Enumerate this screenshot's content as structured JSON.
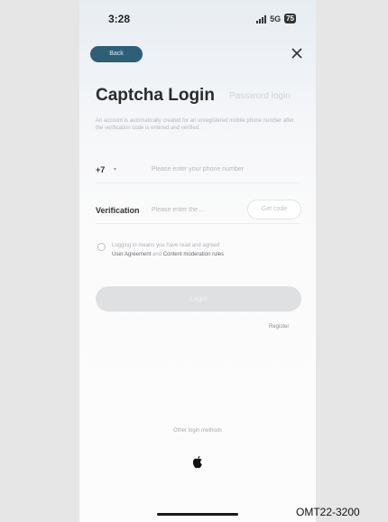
{
  "status_bar": {
    "time": "3:28",
    "network": "5G",
    "battery": "75"
  },
  "header": {
    "back_label": "Back"
  },
  "tabs": {
    "active": "Captcha Login",
    "inactive": "Password login"
  },
  "notice": "An account is automatically created for an unregistered mobile phone number after the verification code is entered and verified.",
  "phone": {
    "country_code": "+7",
    "placeholder": "Please enter your phone number"
  },
  "verification": {
    "label": "Verification",
    "placeholder": "Please enter the ...",
    "get_code_label": "Get code"
  },
  "agreement": {
    "prefix": "Logging in means you have read and agreed",
    "link1": "User Agreement",
    "conjunction": " and ",
    "link2": "Content moderation rules"
  },
  "login_label": "Login",
  "register_label": "Register",
  "other_methods_label": "Other login methods",
  "figure_code": "OMT22-3200",
  "icons": {
    "close": "close-icon",
    "apple": "apple-icon",
    "chevron": "chevron-down-icon"
  },
  "colors": {
    "back_button": "#2f5f78",
    "login_button_disabled": "#dfe0e2"
  }
}
